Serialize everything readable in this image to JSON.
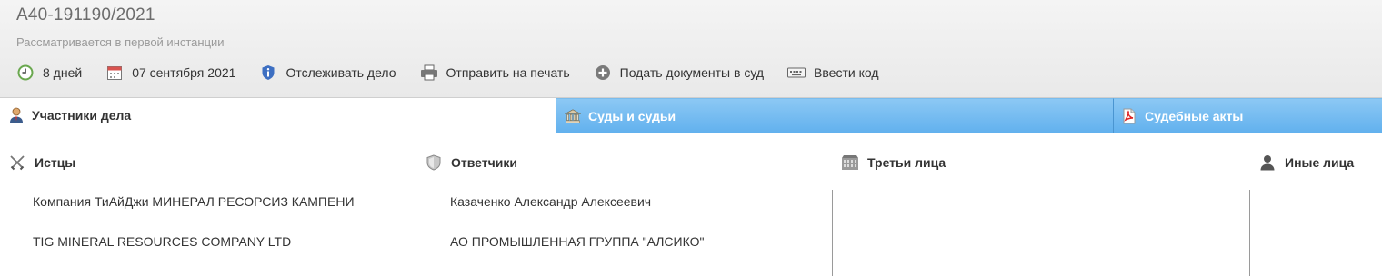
{
  "case": {
    "number": "А40-191190/2021",
    "status": "Рассматривается в первой инстанции"
  },
  "toolbar": {
    "items": [
      {
        "label": "8 дней",
        "icon": "clock-icon"
      },
      {
        "label": "07 сентября 2021",
        "icon": "calendar-icon"
      },
      {
        "label": "Отслеживать дело",
        "icon": "shield-info-icon"
      },
      {
        "label": "Отправить на печать",
        "icon": "printer-icon"
      },
      {
        "label": "Подать документы в суд",
        "icon": "plus-circle-icon"
      },
      {
        "label": "Ввести код",
        "icon": "keyboard-icon"
      }
    ]
  },
  "tabs": [
    {
      "label": "Участники дела",
      "icon": "person-icon",
      "active": true
    },
    {
      "label": "Суды и судьи",
      "icon": "courthouse-icon",
      "active": false
    },
    {
      "label": "Судебные акты",
      "icon": "pdf-icon",
      "active": false
    }
  ],
  "participants": {
    "plaintiffs": {
      "title": "Истцы",
      "icon": "crossed-swords-icon",
      "entries": [
        "Компания ТиАйДжи МИНЕРАЛ РЕСОРСИЗ КАМПЕНИ",
        "TIG MINERAL RESOURCES COMPANY LTD"
      ]
    },
    "defendants": {
      "title": "Ответчики",
      "icon": "shield-icon",
      "entries": [
        "Казаченко Александр Алексеевич",
        "АО ПРОМЫШЛЕННАЯ ГРУППА \"АЛСИКО\""
      ]
    },
    "third_parties": {
      "title": "Третьи лица",
      "icon": "building-icon",
      "entries": []
    },
    "others": {
      "title": "Иные лица",
      "icon": "person-silhouette-icon",
      "entries": []
    }
  },
  "colors": {
    "tab_blue": "#62b1ee",
    "header_bg": "#ececec",
    "text": "#333333"
  }
}
